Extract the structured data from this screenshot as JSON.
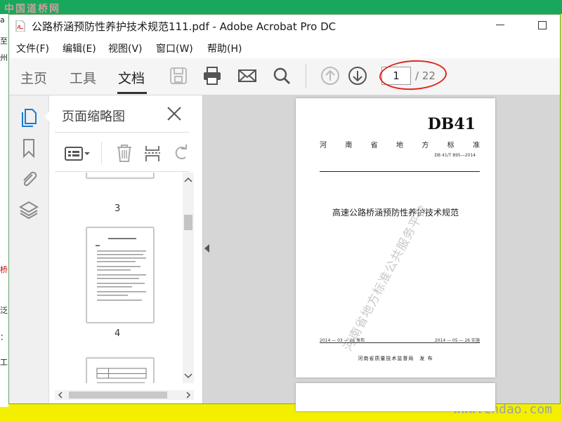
{
  "window": {
    "title": "公路桥涵预防性养护技术规范111.pdf - Adobe Acrobat Pro DC"
  },
  "menu": [
    "文件(F)",
    "编辑(E)",
    "视图(V)",
    "窗口(W)",
    "帮助(H)"
  ],
  "tabs": [
    {
      "label": "主页",
      "active": false
    },
    {
      "label": "工具",
      "active": false
    },
    {
      "label": "文档",
      "active": true
    }
  ],
  "toolbar": {
    "icons": [
      "save-icon",
      "print-icon",
      "email-icon",
      "search-icon",
      "prev-page-icon",
      "next-page-icon"
    ],
    "current_page": "1",
    "total_pages": "/ 22"
  },
  "sidebar": {
    "icons": [
      "pages-icon",
      "bookmark-icon",
      "attachment-icon",
      "layers-icon"
    ]
  },
  "thumbnails": {
    "title": "页面缩略图",
    "pages": [
      "3",
      "4"
    ]
  },
  "document": {
    "code": "DB41",
    "province_standard": [
      "河",
      "南",
      "省",
      "地",
      "方",
      "标",
      "准"
    ],
    "standard_number": "DB 41/T 895—2014",
    "title": "高速公路桥涵预防性养护技术规范",
    "stamp": "河南省地方标准公共服务平台",
    "issue_date": "2014 — 03 — 26 发布",
    "effective_date": "2014 — 05 — 26 实施",
    "publisher": "河南省质量技术监督局　发 布"
  },
  "background": {
    "corner_watermark": "中国道桥网",
    "site_url": "www.cndao.com",
    "left_fragments": [
      "a",
      "至",
      "州",
      "桥",
      "泛",
      "：",
      "工"
    ]
  },
  "colors": {
    "highlight_ellipse": "#e0251f",
    "frame": "#f4ef00",
    "desktop_bar": "#19a85b"
  }
}
